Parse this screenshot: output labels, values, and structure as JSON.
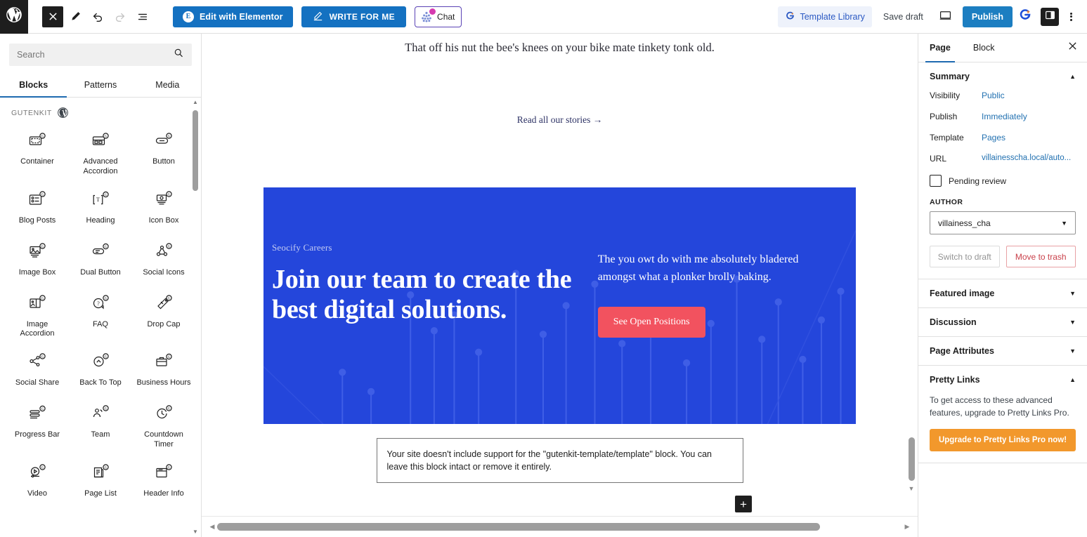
{
  "toolbar": {
    "wp_logo": "wordpress-logo",
    "close_label": "×",
    "tools_icon": "pencil-icon",
    "undo_icon": "undo-icon",
    "redo_icon": "redo-icon",
    "list_view_icon": "list-view-icon",
    "elementor_label": "Edit with Elementor",
    "elementor_badge": "E",
    "write_for_me_label": "WRITE FOR ME",
    "chat_label": "Chat",
    "template_library_label": "Template Library",
    "save_draft_label": "Save draft",
    "preview_label": "preview-icon",
    "publish_label": "Publish",
    "settings_sidebar_icon": "sidebar-toggle-icon",
    "options_icon": "kebab-menu-icon",
    "accent_blue": "#1471c1",
    "publish_blue": "#1c7ec1"
  },
  "inserter": {
    "search": {
      "placeholder": "Search",
      "value": ""
    },
    "tabs": [
      {
        "label": "Blocks",
        "active": true
      },
      {
        "label": "Patterns",
        "active": false
      },
      {
        "label": "Media",
        "active": false
      }
    ],
    "category": "GUTENKIT",
    "blocks": [
      {
        "label": "Container",
        "icon": "container-icon"
      },
      {
        "label": "Advanced Accordion",
        "icon": "advanced-accordion-icon"
      },
      {
        "label": "Button",
        "icon": "button-icon"
      },
      {
        "label": "Blog Posts",
        "icon": "blog-posts-icon"
      },
      {
        "label": "Heading",
        "icon": "heading-icon"
      },
      {
        "label": "Icon Box",
        "icon": "icon-box-icon"
      },
      {
        "label": "Image Box",
        "icon": "image-box-icon"
      },
      {
        "label": "Dual Button",
        "icon": "dual-button-icon"
      },
      {
        "label": "Social Icons",
        "icon": "social-icons-icon"
      },
      {
        "label": "Image Accordion",
        "icon": "image-accordion-icon"
      },
      {
        "label": "FAQ",
        "icon": "faq-icon"
      },
      {
        "label": "Drop Cap",
        "icon": "drop-cap-icon"
      },
      {
        "label": "Social Share",
        "icon": "social-share-icon"
      },
      {
        "label": "Back To Top",
        "icon": "back-to-top-icon"
      },
      {
        "label": "Business Hours",
        "icon": "business-hours-icon"
      },
      {
        "label": "Progress Bar",
        "icon": "progress-bar-icon"
      },
      {
        "label": "Team",
        "icon": "team-icon"
      },
      {
        "label": "Countdown Timer",
        "icon": "countdown-timer-icon"
      },
      {
        "label": "Video",
        "icon": "video-icon"
      },
      {
        "label": "Page List",
        "icon": "page-list-icon"
      },
      {
        "label": "Header Info",
        "icon": "header-info-icon"
      }
    ]
  },
  "canvas": {
    "paragraph": "That off his nut the bee's knees on your bike mate tinkety tonk old.",
    "read_stories_link": "Read all our stories →",
    "hero": {
      "eyebrow": "Seocify Careers",
      "title": "Join our team to create the best digital solutions.",
      "body": "The you owt do with me absolutely bladered amongst what a plonker brolly baking.",
      "cta": "See Open Positions",
      "bg_color": "#2446db",
      "cta_color": "#f2525f"
    },
    "notice": "Your site doesn't include support for the \"gutenkit-template/template\" block. You can leave this block intact or remove it entirely.",
    "add_block_label": "+"
  },
  "sidebar": {
    "tabs": [
      {
        "label": "Page",
        "active": true
      },
      {
        "label": "Block",
        "active": false
      }
    ],
    "close_icon": "close-icon",
    "summary": {
      "title": "Summary",
      "rows": [
        {
          "label": "Visibility",
          "value": "Public"
        },
        {
          "label": "Publish",
          "value": "Immediately"
        },
        {
          "label": "Template",
          "value": "Pages"
        },
        {
          "label": "URL",
          "value": "villainesscha.local/auto..."
        }
      ],
      "pending_review": "Pending review",
      "author_label": "AUTHOR",
      "author_value": "villainess_cha",
      "switch_to_draft": "Switch to draft",
      "move_to_trash": "Move to trash"
    },
    "panels": [
      {
        "title": "Featured image",
        "expanded": false
      },
      {
        "title": "Discussion",
        "expanded": false
      },
      {
        "title": "Page Attributes",
        "expanded": false
      }
    ],
    "pretty_links": {
      "title": "Pretty Links",
      "text": "To get access to these advanced features, upgrade to Pretty Links Pro.",
      "cta": "Upgrade to Pretty Links Pro now!",
      "cta_color": "#f2982c"
    }
  }
}
